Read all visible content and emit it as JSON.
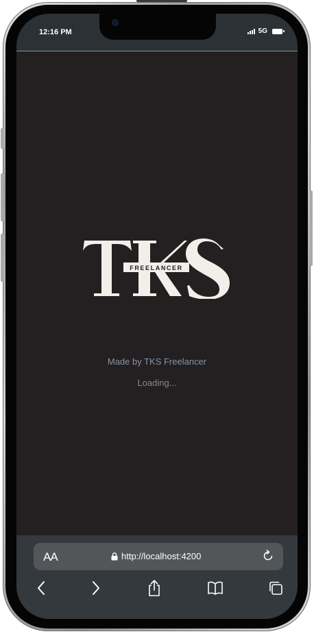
{
  "status_bar": {
    "time": "12:16 PM",
    "network": "5G"
  },
  "brand": {
    "logo_letters": "TKS",
    "logo_tagline": "FREELANCER",
    "logo_color": "#f2efeb"
  },
  "content": {
    "made_by": "Made by TKS Freelancer",
    "loading": "Loading..."
  },
  "browser": {
    "text_size_label": "AA",
    "url": "http://localhost:4200",
    "toolbar_icons": [
      "back-icon",
      "forward-icon",
      "share-icon",
      "bookmarks-icon",
      "tabs-icon"
    ]
  },
  "colors": {
    "screen_background": "#241f20",
    "status_bar": "#2c3135",
    "browser_bar": "#34393d",
    "url_field": "#535659",
    "caption_text": "#8596a8"
  }
}
